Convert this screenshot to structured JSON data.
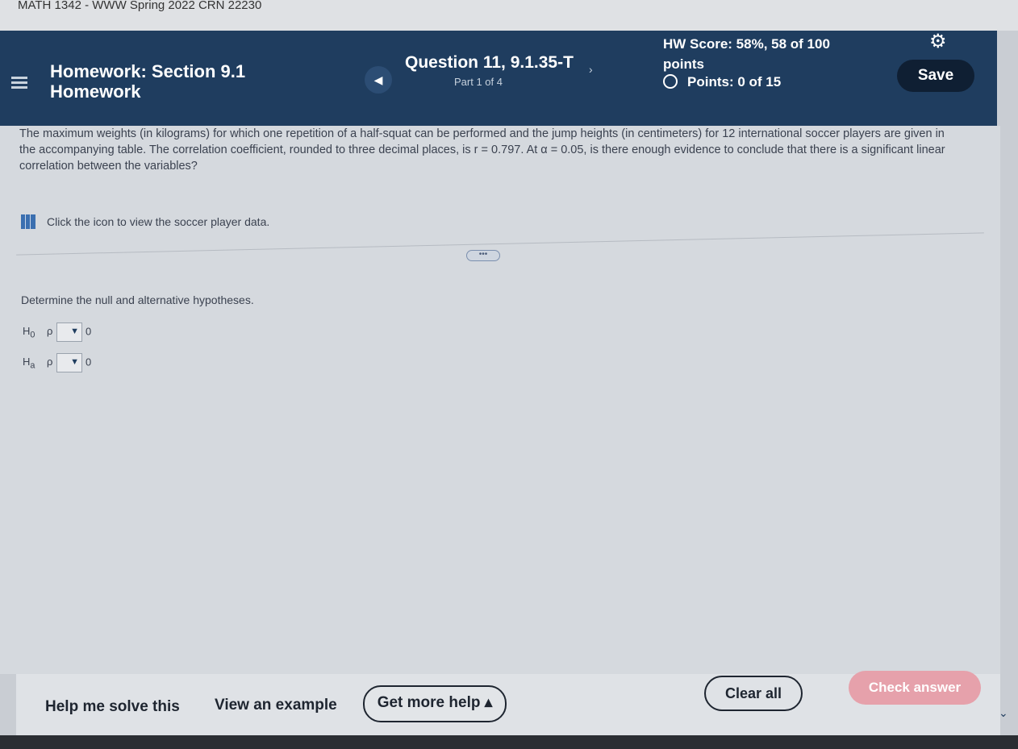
{
  "window": {
    "title": "MATH 1342 - WWW Spring 2022 CRN 22230"
  },
  "header": {
    "homework_label": "Homework:",
    "section": "Section 9.1",
    "homework_word": "Homework",
    "question_title": "Question 11, 9.1.35-T",
    "part": "Part 1 of 4",
    "score_line1": "HW Score: 58%, 58 of 100",
    "score_line2": "points",
    "points": "Points: 0 of 15",
    "save_label": "Save",
    "prev_icon": "chevron-left-icon",
    "next_icon": "chevron-right-icon",
    "settings_icon": "gear-icon"
  },
  "question": {
    "text": "The maximum weights (in kilograms) for which one repetition of a half-squat can be performed and the jump heights (in centimeters) for 12 international soccer players are given in the accompanying table. The correlation coefficient, rounded to three decimal places, is r = 0.797. At α = 0.05, is there enough evidence to conclude that there is a significant linear correlation between the variables?",
    "data_link": "Click the icon to view the soccer player data.",
    "instruction": "Determine the null and alternative hypotheses.",
    "h0_label": "H",
    "h0_sub": "0",
    "ha_label": "H",
    "ha_sub": "a",
    "rho": "ρ",
    "h0_rhs": "0",
    "ha_rhs": "0"
  },
  "footer": {
    "help_solve": "Help me solve this",
    "view_example": "View an example",
    "get_more_help": "Get more help ▴",
    "clear_all": "Clear all",
    "check_answer": "Check answer"
  },
  "colors": {
    "header_bg": "#1f3d5f",
    "save_bg": "#0f1f33",
    "check_answer_bg": "#e6a1ab"
  }
}
